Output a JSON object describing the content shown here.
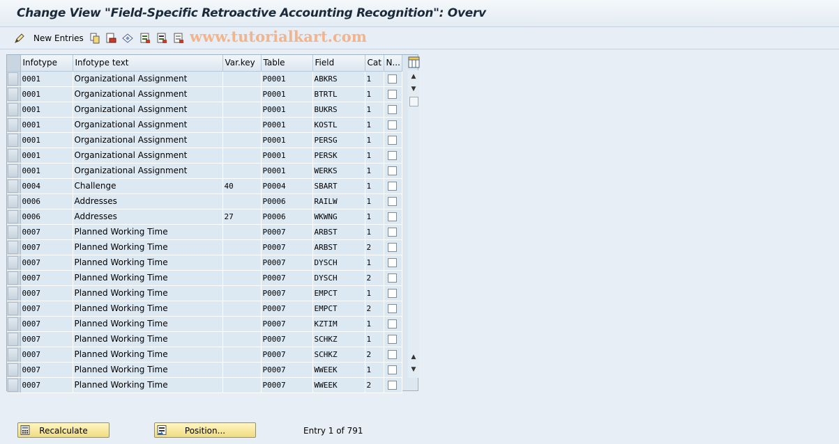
{
  "window": {
    "title": "Change View \"Field-Specific Retroactive Accounting Recognition\": Overv"
  },
  "toolbar": {
    "new_entries_label": "New Entries",
    "watermark": "www.tutorialkart.com",
    "icons": [
      "change-display-icon",
      "copy-icon",
      "delete-icon",
      "undo-icon",
      "select-all-icon",
      "select-block-icon",
      "deselect-all-icon"
    ]
  },
  "table": {
    "columns": [
      "Infotype",
      "Infotype text",
      "Var.key",
      "Table",
      "Field",
      "Cat",
      "N..."
    ],
    "rows": [
      {
        "infotype": "0001",
        "text": "Organizational Assignment",
        "varkey": "",
        "table": "P0001",
        "field": "ABKRS",
        "cat": "1"
      },
      {
        "infotype": "0001",
        "text": "Organizational Assignment",
        "varkey": "",
        "table": "P0001",
        "field": "BTRTL",
        "cat": "1"
      },
      {
        "infotype": "0001",
        "text": "Organizational Assignment",
        "varkey": "",
        "table": "P0001",
        "field": "BUKRS",
        "cat": "1"
      },
      {
        "infotype": "0001",
        "text": "Organizational Assignment",
        "varkey": "",
        "table": "P0001",
        "field": "KOSTL",
        "cat": "1"
      },
      {
        "infotype": "0001",
        "text": "Organizational Assignment",
        "varkey": "",
        "table": "P0001",
        "field": "PERSG",
        "cat": "1"
      },
      {
        "infotype": "0001",
        "text": "Organizational Assignment",
        "varkey": "",
        "table": "P0001",
        "field": "PERSK",
        "cat": "1"
      },
      {
        "infotype": "0001",
        "text": "Organizational Assignment",
        "varkey": "",
        "table": "P0001",
        "field": "WERKS",
        "cat": "1"
      },
      {
        "infotype": "0004",
        "text": "Challenge",
        "varkey": "40",
        "table": "P0004",
        "field": "SBART",
        "cat": "1"
      },
      {
        "infotype": "0006",
        "text": "Addresses",
        "varkey": "",
        "table": "P0006",
        "field": "RAILW",
        "cat": "1"
      },
      {
        "infotype": "0006",
        "text": "Addresses",
        "varkey": "27",
        "table": "P0006",
        "field": "WKWNG",
        "cat": "1"
      },
      {
        "infotype": "0007",
        "text": "Planned Working Time",
        "varkey": "",
        "table": "P0007",
        "field": "ARBST",
        "cat": "1"
      },
      {
        "infotype": "0007",
        "text": "Planned Working Time",
        "varkey": "",
        "table": "P0007",
        "field": "ARBST",
        "cat": "2"
      },
      {
        "infotype": "0007",
        "text": "Planned Working Time",
        "varkey": "",
        "table": "P0007",
        "field": "DYSCH",
        "cat": "1"
      },
      {
        "infotype": "0007",
        "text": "Planned Working Time",
        "varkey": "",
        "table": "P0007",
        "field": "DYSCH",
        "cat": "2"
      },
      {
        "infotype": "0007",
        "text": "Planned Working Time",
        "varkey": "",
        "table": "P0007",
        "field": "EMPCT",
        "cat": "1"
      },
      {
        "infotype": "0007",
        "text": "Planned Working Time",
        "varkey": "",
        "table": "P0007",
        "field": "EMPCT",
        "cat": "2"
      },
      {
        "infotype": "0007",
        "text": "Planned Working Time",
        "varkey": "",
        "table": "P0007",
        "field": "KZTIM",
        "cat": "1"
      },
      {
        "infotype": "0007",
        "text": "Planned Working Time",
        "varkey": "",
        "table": "P0007",
        "field": "SCHKZ",
        "cat": "1"
      },
      {
        "infotype": "0007",
        "text": "Planned Working Time",
        "varkey": "",
        "table": "P0007",
        "field": "SCHKZ",
        "cat": "2"
      },
      {
        "infotype": "0007",
        "text": "Planned Working Time",
        "varkey": "",
        "table": "P0007",
        "field": "WWEEK",
        "cat": "1"
      },
      {
        "infotype": "0007",
        "text": "Planned Working Time",
        "varkey": "",
        "table": "P0007",
        "field": "WWEEK",
        "cat": "2"
      }
    ]
  },
  "footer": {
    "recalculate_label": "Recalculate",
    "position_label": "Position...",
    "entry_info": "Entry 1 of 791"
  },
  "colors": {
    "background": "#e7eef5",
    "row_bg": "#dce8f2",
    "button_bg": "#f1dc80",
    "watermark": "#f2b48c"
  }
}
